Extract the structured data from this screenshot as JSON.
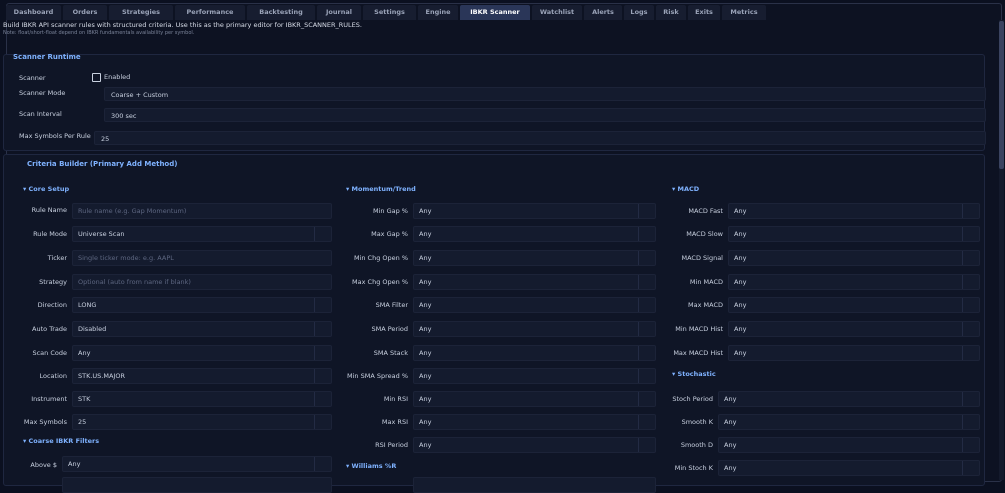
{
  "tabs": [
    {
      "label": "Dashboard",
      "active": false
    },
    {
      "label": "Orders",
      "active": false
    },
    {
      "label": "Strategies",
      "active": false
    },
    {
      "label": "Performance",
      "active": false
    },
    {
      "label": "Backtesting",
      "active": false
    },
    {
      "label": "Journal",
      "active": false
    },
    {
      "label": "Settings",
      "active": false
    },
    {
      "label": "Engine",
      "active": false
    },
    {
      "label": "IBKR Scanner",
      "active": true
    },
    {
      "label": "Watchlist",
      "active": false
    },
    {
      "label": "Alerts",
      "active": false
    },
    {
      "label": "Logs",
      "active": false
    },
    {
      "label": "Risk",
      "active": false
    },
    {
      "label": "Exits",
      "active": false
    },
    {
      "label": "Metrics",
      "active": false
    }
  ],
  "header": {
    "description": "Build IBKR API scanner rules with structured criteria. Use this as the primary editor for IBKR_SCANNER_RULES.",
    "note": "Note: float/short-float depend on IBKR fundamentals availability per symbol."
  },
  "runtime": {
    "title": "Scanner Runtime",
    "scanner_label": "Scanner",
    "enabled_label": "Enabled",
    "enabled": false,
    "mode_label": "Scanner Mode",
    "mode_value": "Coarse + Custom",
    "interval_label": "Scan Interval",
    "interval_value": "300 sec",
    "max_label": "Max Symbols Per Rule",
    "max_value": "25"
  },
  "builder": {
    "title": "Criteria Builder (Primary Add Method)",
    "core_setup": {
      "title": "▾ Core Setup",
      "rule_name": {
        "label": "Rule Name",
        "placeholder": "Rule name (e.g. Gap Momentum)"
      },
      "rule_mode": {
        "label": "Rule Mode",
        "value": "Universe Scan"
      },
      "ticker": {
        "label": "Ticker",
        "placeholder": "Single ticker mode: e.g. AAPL"
      },
      "strategy": {
        "label": "Strategy",
        "placeholder": "Optional (auto from name if blank)"
      },
      "direction": {
        "label": "Direction",
        "value": "LONG"
      },
      "auto_trade": {
        "label": "Auto Trade",
        "value": "Disabled"
      },
      "scan_code": {
        "label": "Scan Code",
        "value": "Any"
      },
      "location": {
        "label": "Location",
        "value": "STK.US.MAJOR"
      },
      "instrument": {
        "label": "Instrument",
        "value": "STK"
      },
      "max_symbols": {
        "label": "Max Symbols",
        "value": "25"
      }
    },
    "coarse_filters": {
      "title": "▾ Coarse IBKR Filters",
      "above": {
        "label": "Above $",
        "value": "Any"
      }
    },
    "momentum": {
      "title": "▾ Momentum/Trend",
      "fields": [
        {
          "label": "Min Gap %",
          "value": "Any"
        },
        {
          "label": "Max Gap %",
          "value": "Any"
        },
        {
          "label": "Min Chg Open %",
          "value": "Any"
        },
        {
          "label": "Max Chg Open %",
          "value": "Any"
        },
        {
          "label": "SMA Filter",
          "value": "Any"
        },
        {
          "label": "SMA Period",
          "value": "Any"
        },
        {
          "label": "SMA Stack",
          "value": "Any"
        },
        {
          "label": "Min SMA Spread %",
          "value": "Any"
        },
        {
          "label": "Min RSI",
          "value": "Any"
        },
        {
          "label": "Max RSI",
          "value": "Any"
        },
        {
          "label": "RSI Period",
          "value": "Any"
        }
      ]
    },
    "williams": {
      "title": "▾ Williams %R"
    },
    "macd": {
      "title": "▾ MACD",
      "fields": [
        {
          "label": "MACD Fast",
          "value": "Any"
        },
        {
          "label": "MACD Slow",
          "value": "Any"
        },
        {
          "label": "MACD Signal",
          "value": "Any"
        },
        {
          "label": "Min MACD",
          "value": "Any"
        },
        {
          "label": "Max MACD",
          "value": "Any"
        },
        {
          "label": "Min MACD Hist",
          "value": "Any"
        },
        {
          "label": "Max MACD Hist",
          "value": "Any"
        }
      ]
    },
    "stochastic": {
      "title": "▾ Stochastic",
      "fields": [
        {
          "label": "Stoch Period",
          "value": "Any"
        },
        {
          "label": "Smooth K",
          "value": "Any"
        },
        {
          "label": "Smooth D",
          "value": "Any"
        },
        {
          "label": "Min Stoch K",
          "value": "Any"
        }
      ]
    }
  }
}
